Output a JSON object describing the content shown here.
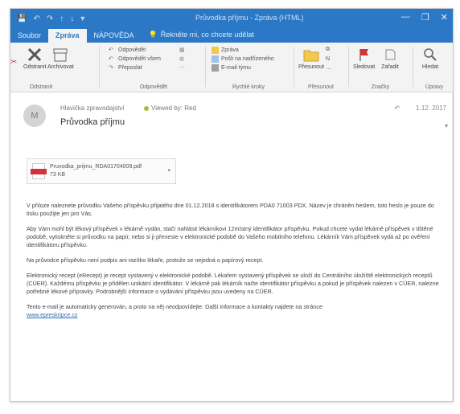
{
  "window": {
    "title": "Průvodka příjmu - Zpráva (HTML)"
  },
  "qat": {
    "save": "💾",
    "undo": "↶",
    "redo": "↷",
    "up": "↑",
    "down": "↓",
    "more": "▾"
  },
  "controls": {
    "min": "—",
    "restore": "❐",
    "close": "✕"
  },
  "tabs": [
    {
      "label": "Soubor"
    },
    {
      "label": "Zpráva"
    },
    {
      "label": "NÁPOVĚDA"
    },
    {
      "label": "Řekněte mi, co chcete udělat"
    }
  ],
  "ribbon": {
    "delete_group": {
      "label": "Odstranit",
      "delete_btn": "Odstranit",
      "archive_btn": "Archivovat"
    },
    "respond_group": {
      "label": "Odpovědět",
      "reply": "Odpovědět",
      "reply_all": "Odpovědět všem",
      "forward": "Přeposlat"
    },
    "quick_group": {
      "label": "Rychlé kroky",
      "item1": "Zpráva",
      "item2": "Pošli na nadřízeného",
      "item3": "E-mail týmu"
    },
    "move_group": {
      "label": "Přesunout",
      "move_btn": "Přesunout"
    },
    "tags_group": {
      "label": "Značky",
      "flag": "Sledovat",
      "category": "Zařadit"
    },
    "find_group": {
      "label": "Úpravy",
      "search": "Hledat"
    }
  },
  "message": {
    "avatar": "M",
    "sender": "Hlavička zpravodajství",
    "flag_status": "Viewed by: Red",
    "subject": "Průvodka příjmu",
    "reply_icon": "↶",
    "date": "1.12. 2017"
  },
  "attachment": {
    "name": "Pruvodka_prijmu_RDA01704009.pdf",
    "size": "73 KB"
  },
  "body": {
    "p1": "V příloze naleznete průvodku Vašeho příspěvku přijatého dne 01.12.2018 s identifikátorem PDA0 71003 PDX. Název je chráněn heslem, toto heslo je pouze do tisku použijte jen pro Vás.",
    "p2": "Aby Vám mohl být lékový příspěvek v lékárně vydán, stačí nahlásit lékárníkovi 12místný identifikátor příspěvku. Pokud chcete vydat lékárně příspěvek v tištěné podobě, vytiskněte si průvodku na papír, nebo si ji přeneste v elektronické podobě do Vašeho mobilního telefonu. Lékárník Vám příspěvek vydá až po ověření identifikátoru příspěvku.",
    "p3": "Na průvodce příspěvku není podpis ani razítko lékaře, protože se nejedná o papírový recept.",
    "p4": "Elektronický recept (eRecept) je recept vystavený v elektronické podobě. Lékařem vystavený příspěvek se uloží do Centrálního úložiště elektronických receptů (CÚER). Každému příspěvku je přidělen unikátní identifikátor. V lékárně pak lékárník načte identifikátor příspěvku a pokud je příspěvek nalezen v CÚER, nalezne potřebné lékové přípravky. Podrobnější informace o vydávání příspěvku jsou uvedeny na CÚER.",
    "p5": "Tento e-mail je automaticky generován, a proto na něj neodpovídejte. Další informace a kontakty najdete na stránce",
    "link": "www.epreskripce.cz"
  }
}
